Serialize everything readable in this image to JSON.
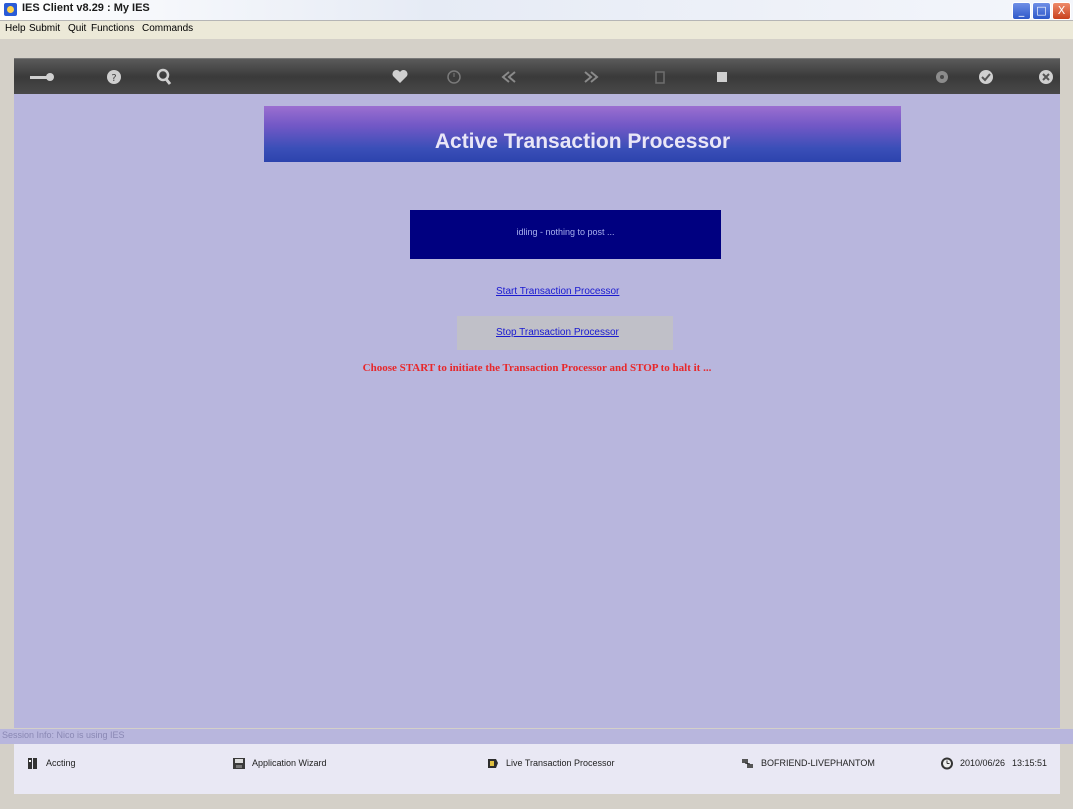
{
  "window": {
    "title": "IES Client v8.29 : My IES",
    "controls": {
      "minimize": "_",
      "maximize": "□",
      "close": "X"
    }
  },
  "menu": [
    "Help",
    "Submit",
    "Quit",
    "Functions",
    "Commands"
  ],
  "toolbar": {
    "icons": [
      "key-icon",
      "help-icon",
      "search-icon",
      "heart-icon",
      "clock-icon",
      "rewind-icon",
      "forward-icon",
      "trash-icon",
      "stop-icon",
      "settings-icon",
      "check-icon",
      "close-icon"
    ]
  },
  "main": {
    "banner_title": "Active Transaction Processor",
    "status_text": "idling - nothing to post ...",
    "start_link": "Start Transaction Processor",
    "stop_link": "Stop Transaction Processor",
    "instruction": "Choose START to initiate the Transaction  Processor and STOP to halt it ..."
  },
  "session": {
    "info": "Session Info: Nico is using IES"
  },
  "statusbar": {
    "items": [
      {
        "label": "Accting",
        "icon": "book-icon"
      },
      {
        "label": "Application Wizard",
        "icon": "disk-icon"
      },
      {
        "label": "Live Transaction Processor",
        "icon": "processor-icon"
      },
      {
        "label": "BOFRIEND-LIVEPHANTOM",
        "icon": "network-icon"
      },
      {
        "label": "2010/06/26",
        "icon": "clock-icon"
      },
      {
        "label": "13:15:51",
        "icon": ""
      }
    ]
  },
  "colors": {
    "background": "#b8b6dd",
    "status_panel": "#000080",
    "instruction_text": "#e8272a",
    "link": "#1a1ad0"
  }
}
